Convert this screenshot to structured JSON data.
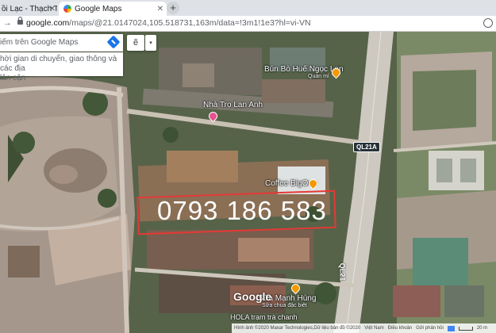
{
  "browser": {
    "tabs": [
      {
        "title": "ồi Lạc - Thạch Thất"
      },
      {
        "title": "Google Maps"
      }
    ],
    "new_tab_symbol": "+",
    "close_symbol": "✕",
    "url_host": "google.com",
    "url_path": "/maps/@21.0147024,105.518731,163m/data=!3m1!1e3?hl=vi-VN"
  },
  "maps": {
    "search_placeholder": "iếm trên Google Maps",
    "suggest_line1": "hời gian di chuyển, giao thông và các địa",
    "suggest_line2": "lân cận",
    "chip_label": "ẽ",
    "chip_arrow": "▾",
    "places": [
      {
        "name": "Bún Bò Huế Ngọc Lan",
        "sub": "Quán mì"
      },
      {
        "name": "Nhà Trọ Lan Anh"
      },
      {
        "name": "Coffee BigOne"
      },
      {
        "name": "Sữa Mạnh Hùng",
        "sub": "Sữa chua đặc biệt"
      },
      {
        "name": "HOLA trạm trà chanh"
      }
    ],
    "road_shield": "QL21A",
    "road_label": "QL21",
    "phone_overlay": "0793 186 583",
    "google_logo": "Google",
    "footer": {
      "imagery": "Hình ảnh ©2020 Maxar Technologies,Dữ liệu bản đồ ©2020",
      "links": [
        "Việt Nam",
        "Điều khoản",
        "Gửi phản hồi"
      ],
      "scale": "20 m"
    }
  },
  "colors": {
    "accent": "#1a73e8",
    "overlay_red": "#e53935",
    "food_pin": "#f29900",
    "hotel_pin": "#e8508f"
  }
}
